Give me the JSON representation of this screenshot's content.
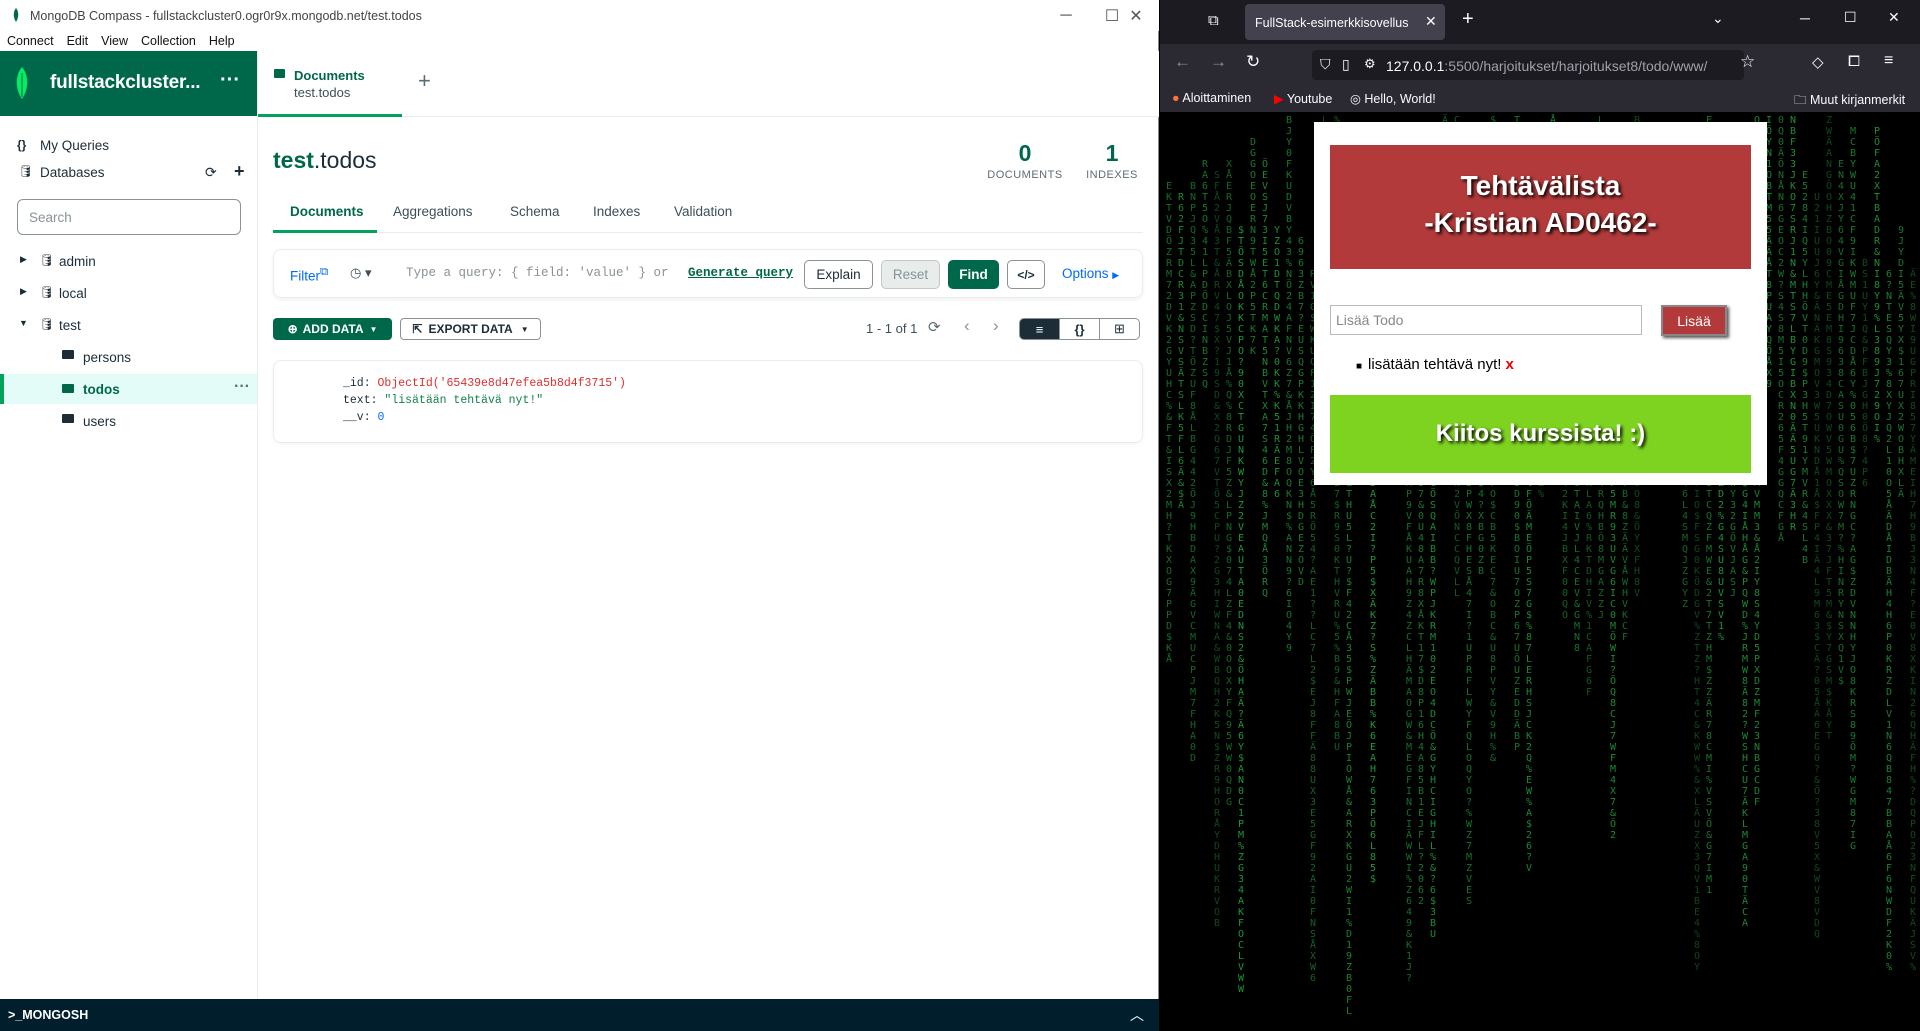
{
  "compass": {
    "window_title": "MongoDB Compass - fullstackcluster0.ogr0r9x.mongodb.net/test.todos",
    "menu": [
      "Connect",
      "Edit",
      "View",
      "Collection",
      "Help"
    ],
    "cluster_name": "fullstackcluster...",
    "sidebar": {
      "my_queries": "My Queries",
      "databases": "Databases",
      "search_placeholder": "Search",
      "dbs": [
        "admin",
        "local",
        "test"
      ],
      "collections": [
        "persons",
        "todos",
        "users"
      ]
    },
    "tab": {
      "title": "Documents",
      "subtitle": "test.todos"
    },
    "collection_db": "test",
    "collection_name": ".todos",
    "stats": {
      "documents_count": "0",
      "documents_label": "DOCUMENTS",
      "indexes_count": "1",
      "indexes_label": "INDEXES"
    },
    "subtabs": [
      "Documents",
      "Aggregations",
      "Schema",
      "Indexes",
      "Validation"
    ],
    "query": {
      "filter_label": "Filter",
      "placeholder": "Type a query: { field: 'value' } or",
      "generate": "Generate query",
      "explain": "Explain",
      "reset": "Reset",
      "find": "Find",
      "code": "</>",
      "options": "Options"
    },
    "add_data": "ADD DATA",
    "export_data": "EXPORT DATA",
    "pager": "1 - 1 of 1",
    "document": {
      "id_key": "_id:",
      "id_val": "ObjectId('65439e8d47efea5b8d4f3715')",
      "text_key": "text:",
      "text_val": "\"lisätään tehtävä nyt!\"",
      "v_key": "__v:",
      "v_val": "0"
    },
    "mongosh": ">_MONGOSH"
  },
  "firefox": {
    "tab_title": "FullStack-esimerkkisovellus",
    "url_host": "127.0.0.1",
    "url_path": ":5500/harjoitukset/harjoitukset8/todo/www/",
    "bookmarks": [
      "Aloittaminen",
      "Youtube",
      "Hello, World!"
    ],
    "other_bookmarks": "Muut kirjanmerkit"
  },
  "app": {
    "title_line1": "Tehtävälista",
    "title_line2": "-Kristian AD0462-",
    "input_placeholder": "Lisää Todo",
    "add_button": "Lisää",
    "todo_item": "lisätään tehtävä nyt!",
    "delete_mark": "x",
    "thanks": "Kiitos kurssista! :)"
  },
  "colors": {
    "compass_green": "#00684a",
    "accent_green": "#00a35c",
    "header_red": "#b23a3a",
    "thanks_green": "#7ed321",
    "matrix_green": "#1f9c3a"
  }
}
